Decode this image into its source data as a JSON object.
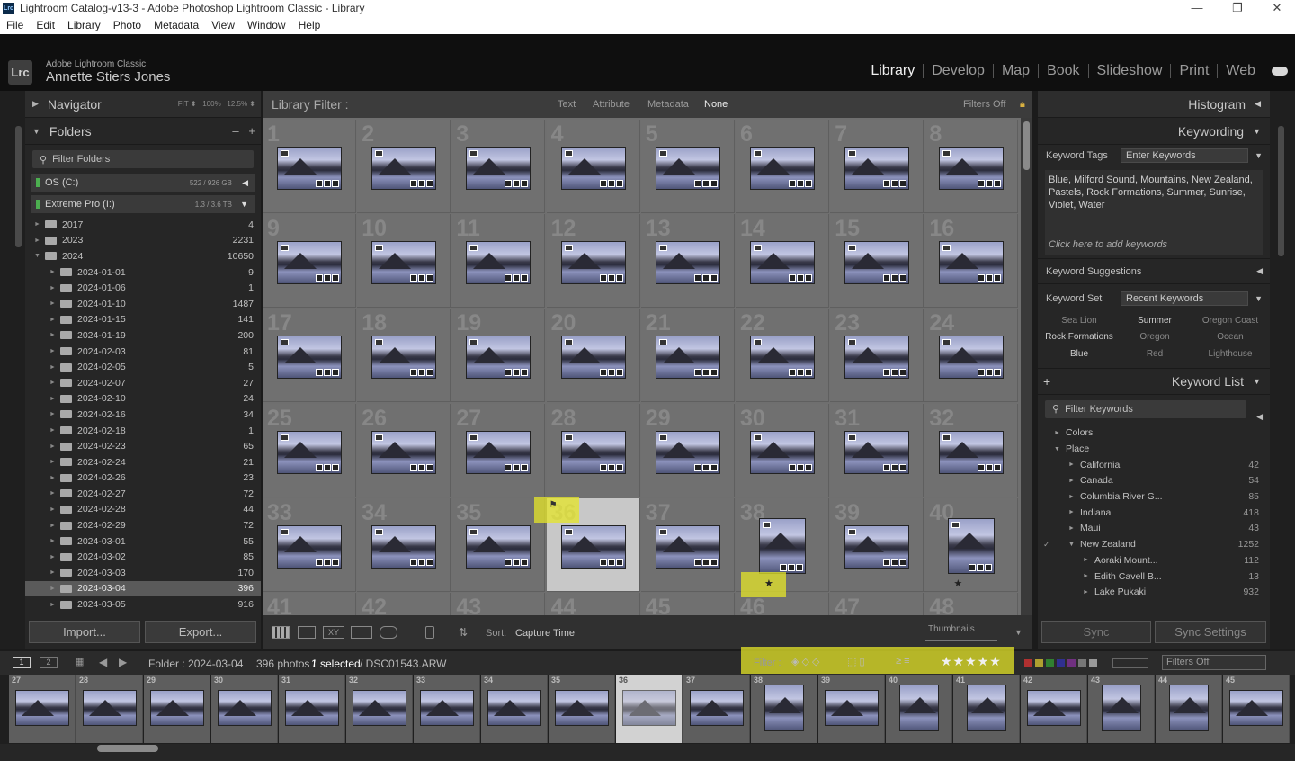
{
  "window": {
    "title": "Lightroom Catalog-v13-3 - Adobe Photoshop Lightroom Classic - Library",
    "app_icon": "Lrc",
    "controls": [
      "—",
      "❐",
      "✕"
    ]
  },
  "menu": [
    "File",
    "Edit",
    "Library",
    "Photo",
    "Metadata",
    "View",
    "Window",
    "Help"
  ],
  "identity": {
    "logo": "Lrc",
    "subtitle": "Adobe Lightroom Classic",
    "name": "Annette Stiers Jones"
  },
  "modules": [
    "Library",
    "Develop",
    "Map",
    "Book",
    "Slideshow",
    "Print",
    "Web"
  ],
  "active_module": "Library",
  "navigator": {
    "title": "Navigator",
    "fit": "FIT",
    "z1": "100%",
    "z2": "12.5%"
  },
  "folders": {
    "title": "Folders",
    "minus": "–",
    "plus": "+",
    "filter": "Filter Folders",
    "volumes": [
      {
        "name": "OS (C:)",
        "size": "522 / 926 GB"
      },
      {
        "name": "Extreme Pro (I:)",
        "size": "1.3 / 3.6 TB"
      }
    ],
    "items": [
      {
        "name": "2017",
        "count": "4",
        "level": 0,
        "exp": "►"
      },
      {
        "name": "2023",
        "count": "2231",
        "level": 0,
        "exp": "►"
      },
      {
        "name": "2024",
        "count": "10650",
        "level": 0,
        "exp": "▼"
      },
      {
        "name": "2024-01-01",
        "count": "9",
        "level": 1,
        "exp": "►"
      },
      {
        "name": "2024-01-06",
        "count": "1",
        "level": 1,
        "exp": "►"
      },
      {
        "name": "2024-01-10",
        "count": "1487",
        "level": 1,
        "exp": "►"
      },
      {
        "name": "2024-01-15",
        "count": "141",
        "level": 1,
        "exp": "►"
      },
      {
        "name": "2024-01-19",
        "count": "200",
        "level": 1,
        "exp": "►"
      },
      {
        "name": "2024-02-03",
        "count": "81",
        "level": 1,
        "exp": "►"
      },
      {
        "name": "2024-02-05",
        "count": "5",
        "level": 1,
        "exp": "►"
      },
      {
        "name": "2024-02-07",
        "count": "27",
        "level": 1,
        "exp": "►"
      },
      {
        "name": "2024-02-10",
        "count": "24",
        "level": 1,
        "exp": "►"
      },
      {
        "name": "2024-02-16",
        "count": "34",
        "level": 1,
        "exp": "►"
      },
      {
        "name": "2024-02-18",
        "count": "1",
        "level": 1,
        "exp": "►"
      },
      {
        "name": "2024-02-23",
        "count": "65",
        "level": 1,
        "exp": "►"
      },
      {
        "name": "2024-02-24",
        "count": "21",
        "level": 1,
        "exp": "►"
      },
      {
        "name": "2024-02-26",
        "count": "23",
        "level": 1,
        "exp": "►"
      },
      {
        "name": "2024-02-27",
        "count": "72",
        "level": 1,
        "exp": "►"
      },
      {
        "name": "2024-02-28",
        "count": "44",
        "level": 1,
        "exp": "►"
      },
      {
        "name": "2024-02-29",
        "count": "72",
        "level": 1,
        "exp": "►"
      },
      {
        "name": "2024-03-01",
        "count": "55",
        "level": 1,
        "exp": "►"
      },
      {
        "name": "2024-03-02",
        "count": "85",
        "level": 1,
        "exp": "►"
      },
      {
        "name": "2024-03-03",
        "count": "170",
        "level": 1,
        "exp": "►"
      },
      {
        "name": "2024-03-04",
        "count": "396",
        "level": 1,
        "exp": "►",
        "selected": true
      },
      {
        "name": "2024-03-05",
        "count": "916",
        "level": 1,
        "exp": "►"
      }
    ]
  },
  "left_buttons": {
    "import": "Import...",
    "export": "Export..."
  },
  "library_filter": {
    "label": "Library Filter :",
    "options": [
      "Text",
      "Attribute",
      "Metadata",
      "None"
    ],
    "active": "None",
    "status": "Filters Off"
  },
  "grid": {
    "cells": [
      {
        "n": "1",
        "o": "l"
      },
      {
        "n": "2",
        "o": "l"
      },
      {
        "n": "3",
        "o": "l"
      },
      {
        "n": "4",
        "o": "l"
      },
      {
        "n": "5",
        "o": "l"
      },
      {
        "n": "6",
        "o": "l"
      },
      {
        "n": "7",
        "o": "l"
      },
      {
        "n": "8",
        "o": "l"
      },
      {
        "n": "9",
        "o": "l"
      },
      {
        "n": "10",
        "o": "l"
      },
      {
        "n": "11",
        "o": "l"
      },
      {
        "n": "12",
        "o": "l"
      },
      {
        "n": "13",
        "o": "l"
      },
      {
        "n": "14",
        "o": "l"
      },
      {
        "n": "15",
        "o": "l"
      },
      {
        "n": "16",
        "o": "l"
      },
      {
        "n": "17",
        "o": "l"
      },
      {
        "n": "18",
        "o": "l"
      },
      {
        "n": "19",
        "o": "l"
      },
      {
        "n": "20",
        "o": "l"
      },
      {
        "n": "21",
        "o": "l"
      },
      {
        "n": "22",
        "o": "l"
      },
      {
        "n": "23",
        "o": "l"
      },
      {
        "n": "24",
        "o": "l"
      },
      {
        "n": "25",
        "o": "l"
      },
      {
        "n": "26",
        "o": "l"
      },
      {
        "n": "27",
        "o": "l"
      },
      {
        "n": "28",
        "o": "l"
      },
      {
        "n": "29",
        "o": "l"
      },
      {
        "n": "30",
        "o": "l"
      },
      {
        "n": "31",
        "o": "l"
      },
      {
        "n": "32",
        "o": "l"
      },
      {
        "n": "33",
        "o": "l"
      },
      {
        "n": "34",
        "o": "l"
      },
      {
        "n": "35",
        "o": "l"
      },
      {
        "n": "36",
        "o": "l",
        "selected": true,
        "flag": true
      },
      {
        "n": "37",
        "o": "l"
      },
      {
        "n": "38",
        "o": "p",
        "star": "★"
      },
      {
        "n": "39",
        "o": "l"
      },
      {
        "n": "40",
        "o": "p",
        "star": "★"
      },
      {
        "n": "41",
        "o": "l"
      },
      {
        "n": "42",
        "o": "l"
      },
      {
        "n": "43",
        "o": "l"
      },
      {
        "n": "44",
        "o": "l"
      },
      {
        "n": "45",
        "o": "l"
      },
      {
        "n": "46",
        "o": "l"
      },
      {
        "n": "47",
        "o": "l"
      },
      {
        "n": "48",
        "o": "l"
      }
    ]
  },
  "toolbar": {
    "sort_label": "Sort:",
    "sort_value": "Capture Time",
    "thumbnails_label": "Thumbnails"
  },
  "right": {
    "histogram": "Histogram",
    "keywording": "Keywording",
    "keyword_tags_label": "Keyword Tags",
    "keyword_tags_value": "Enter Keywords",
    "keywords_text": "Blue, Milford Sound, Mountains, New Zealand, Pastels, Rock Formations, Summer, Sunrise, Violet, Water",
    "add_hint": "Click here to add keywords",
    "suggestions": "Keyword Suggestions",
    "keyword_set_label": "Keyword Set",
    "keyword_set_value": "Recent Keywords",
    "recent": [
      {
        "t": "Sea Lion",
        "on": false
      },
      {
        "t": "Summer",
        "on": true
      },
      {
        "t": "Oregon Coast",
        "on": false
      },
      {
        "t": "Rock Formations",
        "on": true
      },
      {
        "t": "Oregon",
        "on": false
      },
      {
        "t": "Ocean",
        "on": false
      },
      {
        "t": "Blue",
        "on": true
      },
      {
        "t": "Red",
        "on": false
      },
      {
        "t": "Lighthouse",
        "on": false
      }
    ],
    "keyword_list": "Keyword List",
    "plus": "+",
    "filter_keywords": "Filter Keywords",
    "list": [
      {
        "name": "Colors",
        "count": "",
        "level": 0,
        "exp": "►"
      },
      {
        "name": "Place",
        "count": "",
        "level": 0,
        "exp": "▼"
      },
      {
        "name": "California",
        "count": "42",
        "level": 1,
        "exp": "►"
      },
      {
        "name": "Canada",
        "count": "54",
        "level": 1,
        "exp": "►"
      },
      {
        "name": "Columbia River G...",
        "count": "85",
        "level": 1,
        "exp": "►"
      },
      {
        "name": "Indiana",
        "count": "418",
        "level": 1,
        "exp": "►"
      },
      {
        "name": "Maui",
        "count": "43",
        "level": 1,
        "exp": "►"
      },
      {
        "name": "New Zealand",
        "count": "1252",
        "level": 1,
        "exp": "▼",
        "check": "✓"
      },
      {
        "name": "Aoraki Mount...",
        "count": "112",
        "level": 2,
        "exp": "►"
      },
      {
        "name": "Edith Cavell B...",
        "count": "13",
        "level": 2,
        "exp": "►"
      },
      {
        "name": "Lake Pukaki",
        "count": "932",
        "level": 2,
        "exp": "►"
      }
    ],
    "sync": "Sync",
    "sync_settings": "Sync Settings"
  },
  "filmstrip_bar": {
    "page1": "1",
    "page2": "2",
    "folder": "Folder : 2024-03-04",
    "count": "396 photos /",
    "selected": "1 selected",
    "file": "/ DSC01543.ARW",
    "filter_label": "Filter :",
    "stars": "★★★★★",
    "filters_off": "Filters Off"
  },
  "filmstrip": [
    {
      "n": "27",
      "o": "l"
    },
    {
      "n": "28",
      "o": "l"
    },
    {
      "n": "29",
      "o": "l"
    },
    {
      "n": "30",
      "o": "l"
    },
    {
      "n": "31",
      "o": "l"
    },
    {
      "n": "32",
      "o": "l"
    },
    {
      "n": "33",
      "o": "l"
    },
    {
      "n": "34",
      "o": "l"
    },
    {
      "n": "35",
      "o": "l"
    },
    {
      "n": "36",
      "o": "l",
      "selected": true
    },
    {
      "n": "37",
      "o": "l"
    },
    {
      "n": "38",
      "o": "p"
    },
    {
      "n": "39",
      "o": "l"
    },
    {
      "n": "40",
      "o": "p"
    },
    {
      "n": "41",
      "o": "p"
    },
    {
      "n": "42",
      "o": "l"
    },
    {
      "n": "43",
      "o": "p"
    },
    {
      "n": "44",
      "o": "p"
    },
    {
      "n": "45",
      "o": "l"
    }
  ],
  "colors": {
    "highlight": "#e6e628",
    "label_red": "#b03030",
    "label_yellow": "#b0a030",
    "label_green": "#308030",
    "label_blue": "#303090",
    "label_purple": "#703080"
  }
}
